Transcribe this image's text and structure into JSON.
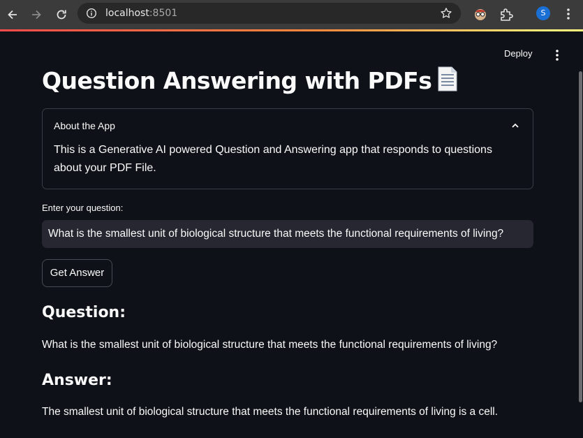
{
  "browser": {
    "url_host": "localhost",
    "url_port": ":8501",
    "profile_initial": "S"
  },
  "header": {
    "deploy_label": "Deploy"
  },
  "page": {
    "title": "Question Answering with PDFs",
    "title_icon": "page-facing-up-icon"
  },
  "about": {
    "label": "About the App",
    "body": "This is a Generative AI powered Question and Answering app that responds to questions about your PDF File."
  },
  "form": {
    "question_label": "Enter your question:",
    "question_value": "What is the smallest unit of biological structure that meets the functional requirements of living?",
    "submit_label": "Get Answer"
  },
  "result": {
    "question_heading": "Question:",
    "question_text": "What is the smallest unit of biological structure that meets the functional requirements of living?",
    "answer_heading": "Answer:",
    "answer_text": "The smallest unit of biological structure that meets the functional requirements of living is a cell."
  },
  "colors": {
    "background": "#0e1117",
    "input_background": "#262730",
    "text": "#fafafa",
    "accent_gradient_start": "#ff4b4b",
    "accent_gradient_end": "#fffd80"
  }
}
